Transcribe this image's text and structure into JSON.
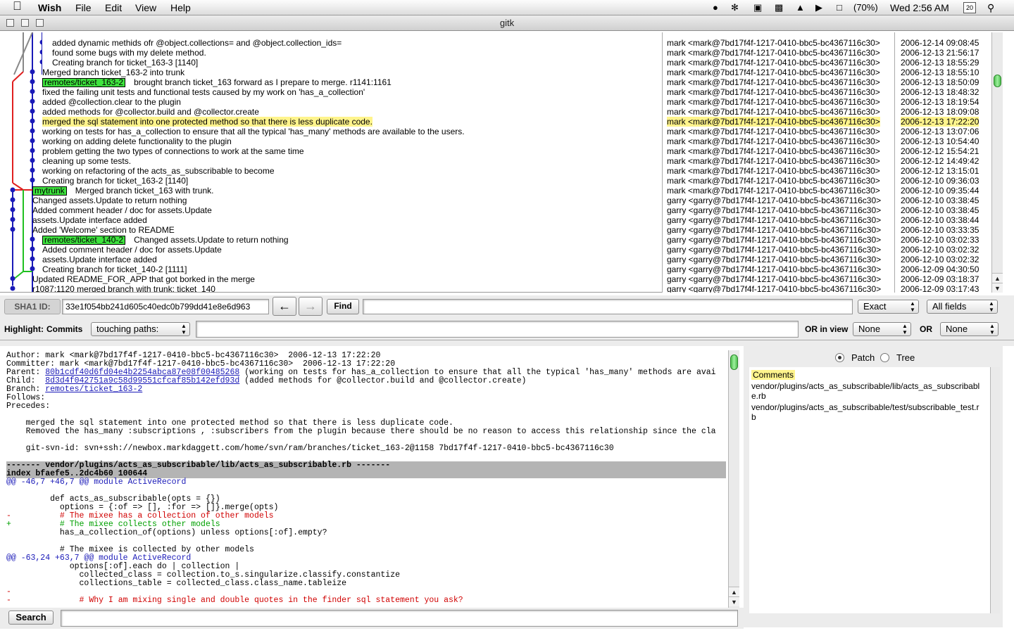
{
  "menubar": {
    "app": "Wish",
    "items": [
      "File",
      "Edit",
      "View",
      "Help"
    ],
    "battery": "(70%)",
    "clock": "Wed 2:56 AM",
    "cal_day": "20"
  },
  "window": {
    "title": "gitk"
  },
  "commits": [
    {
      "msg": "added dynamic methids ofr @object.collections= and @object.collection_ids=",
      "author": "mark <mark@7bd17f4f-1217-0410-bbc5-bc4367116c30>",
      "date": "2006-12-14 09:08:45"
    },
    {
      "msg": "found some bugs with my delete method.",
      "author": "mark <mark@7bd17f4f-1217-0410-bbc5-bc4367116c30>",
      "date": "2006-12-13 21:56:17"
    },
    {
      "msg": "Creating branch for ticket_163-3 [1140]",
      "author": "mark <mark@7bd17f4f-1217-0410-bbc5-bc4367116c30>",
      "date": "2006-12-13 18:55:29"
    },
    {
      "msg": "Merged branch ticket_163-2 into trunk",
      "author": "mark <mark@7bd17f4f-1217-0410-bbc5-bc4367116c30>",
      "date": "2006-12-13 18:55:10"
    },
    {
      "ref": "remotes/ticket_163-2",
      "msg": "brought branch ticket_163 forward as I prepare to merge. r1141:1161",
      "author": "mark <mark@7bd17f4f-1217-0410-bbc5-bc4367116c30>",
      "date": "2006-12-13 18:50:09"
    },
    {
      "msg": "fixed the failing unit tests and functional tests caused by my work on 'has_a_collection'",
      "author": "mark <mark@7bd17f4f-1217-0410-bbc5-bc4367116c30>",
      "date": "2006-12-13 18:48:32"
    },
    {
      "msg": "added @collection.clear to the plugin",
      "author": "mark <mark@7bd17f4f-1217-0410-bbc5-bc4367116c30>",
      "date": "2006-12-13 18:19:54"
    },
    {
      "msg": "added methods for @collector.build and @collector.create",
      "author": "mark <mark@7bd17f4f-1217-0410-bbc5-bc4367116c30>",
      "date": "2006-12-13 18:09:08"
    },
    {
      "msg": "merged the sql statement into one protected method so that there is less duplicate code.",
      "author": "mark <mark@7bd17f4f-1217-0410-bbc5-bc4367116c30>",
      "date": "2006-12-13 17:22:20",
      "selected": true
    },
    {
      "msg": "working on tests for has_a_collection to ensure that all the typical 'has_many' methods are available to the users.",
      "author": "mark <mark@7bd17f4f-1217-0410-bbc5-bc4367116c30>",
      "date": "2006-12-13 13:07:06"
    },
    {
      "msg": "working on adding delete functionality to the plugin",
      "author": "mark <mark@7bd17f4f-1217-0410-bbc5-bc4367116c30>",
      "date": "2006-12-13 10:54:40"
    },
    {
      "msg": "problem getting the two types of connections to work at the same time",
      "author": "mark <mark@7bd17f4f-1217-0410-bbc5-bc4367116c30>",
      "date": "2006-12-12 15:54:21"
    },
    {
      "msg": "cleaning up some tests.",
      "author": "mark <mark@7bd17f4f-1217-0410-bbc5-bc4367116c30>",
      "date": "2006-12-12 14:49:42"
    },
    {
      "msg": "working on refactoring of the acts_as_subscribable to become",
      "author": "mark <mark@7bd17f4f-1217-0410-bbc5-bc4367116c30>",
      "date": "2006-12-12 13:15:01"
    },
    {
      "msg": "Creating branch for ticket_163-2 [1140]",
      "author": "mark <mark@7bd17f4f-1217-0410-bbc5-bc4367116c30>",
      "date": "2006-12-10 09:36:03"
    },
    {
      "ref": "mytrunk",
      "msg": "Merged branch ticket_163 with trunk.",
      "author": "mark <mark@7bd17f4f-1217-0410-bbc5-bc4367116c30>",
      "date": "2006-12-10 09:35:44"
    },
    {
      "msg": "Changed assets.Update to return nothing",
      "author": "garry <garry@7bd17f4f-1217-0410-bbc5-bc4367116c30>",
      "date": "2006-12-10 03:38:45"
    },
    {
      "msg": "Added comment header / doc for assets.Update",
      "author": "garry <garry@7bd17f4f-1217-0410-bbc5-bc4367116c30>",
      "date": "2006-12-10 03:38:45"
    },
    {
      "msg": "assets.Update interface added",
      "author": "garry <garry@7bd17f4f-1217-0410-bbc5-bc4367116c30>",
      "date": "2006-12-10 03:38:44"
    },
    {
      "msg": "Added 'Welcome' section to README",
      "author": "garry <garry@7bd17f4f-1217-0410-bbc5-bc4367116c30>",
      "date": "2006-12-10 03:33:35"
    },
    {
      "ref": "remotes/ticket_140-2",
      "msg": "Changed assets.Update to return nothing",
      "author": "garry <garry@7bd17f4f-1217-0410-bbc5-bc4367116c30>",
      "date": "2006-12-10 03:02:33"
    },
    {
      "msg": "Added comment header / doc for assets.Update",
      "author": "garry <garry@7bd17f4f-1217-0410-bbc5-bc4367116c30>",
      "date": "2006-12-10 03:02:32"
    },
    {
      "msg": "assets.Update interface added",
      "author": "garry <garry@7bd17f4f-1217-0410-bbc5-bc4367116c30>",
      "date": "2006-12-10 03:02:32"
    },
    {
      "msg": "Creating branch for ticket_140-2 [1111]",
      "author": "garry <garry@7bd17f4f-1217-0410-bbc5-bc4367116c30>",
      "date": "2006-12-09 04:30:50"
    },
    {
      "msg": "Updated README_FOR_APP that got borked in the merge",
      "author": "garry <garry@7bd17f4f-1217-0410-bbc5-bc4367116c30>",
      "date": "2006-12-09 03:18:37"
    },
    {
      "msg": "r1087:1120 merged branch with trunk: ticket_140",
      "author": "garry <garry@7bd17f4f-1217-0410-bbc5-bc4367116c30>",
      "date": "2006-12-09 03:17:43"
    }
  ],
  "sha": {
    "label": "SHA1 ID:",
    "value": "33e1f054bb241d605c40edc0b799dd41e8e6d963",
    "find_label": "Find",
    "find_value": "",
    "mode": "Exact",
    "fields": "All fields"
  },
  "highlight": {
    "label": "Highlight:",
    "commits_label": "Commits",
    "paths_option": "touching paths:",
    "value": "",
    "or_in_view_label": "OR in view",
    "view_option": "None",
    "or_label": "OR",
    "or_option": "None"
  },
  "details": {
    "author": "Author: mark <mark@7bd17f4f-1217-0410-bbc5-bc4367116c30>  2006-12-13 17:22:20",
    "committer": "Committer: mark <mark@7bd17f4f-1217-0410-bbc5-bc4367116c30>  2006-12-13 17:22:20",
    "parent_label": "Parent: ",
    "parent_sha": "80b1cdf40d6fd04e4b2254abca87e08f00485268",
    "parent_msg": " (working on tests for has_a_collection to ensure that all the typical 'has_many' methods are avai",
    "child_label": "Child:  ",
    "child_sha": "8d3d4f042751a9c58d99551cfcaf85b142efd93d",
    "child_msg": " (added methods for @collector.build and @collector.create)",
    "branch_label": "Branch: ",
    "branch_name": "remotes/ticket_163-2",
    "follows": "Follows:",
    "precedes": "Precedes:",
    "body1": "    merged the sql statement into one protected method so that there is less duplicate code.",
    "body2": "    Removed the has_many :subscriptions , :subscribers from the plugin because there should be no reason to access this relationship since the cla",
    "body3": "    git-svn-id: svn+ssh://newbox.markdaggett.com/home/svn/ram/branches/ticket_163-2@1158 7bd17f4f-1217-0410-bbc5-bc4367116c30",
    "file_header": "------- vendor/plugins/acts_as_subscribable/lib/acts_as_subscribable.rb -------",
    "index_line": "index bfaefe5..2dc4b60 100644",
    "hunk1": "@@ -46,7 +46,7 @@ module ActiveRecord",
    "c1": "         def acts_as_subscribable(opts = {})",
    "c2": "           options = {:of => [], :for => []}.merge(opts)",
    "c3": "-          # The mixee has a collection of other models",
    "c4": "+          # The mixee collects other models",
    "c5": "           has_a_collection_of(options) unless options[:of].empty?",
    "c6": "",
    "c7": "           # The mixee is collected by other models",
    "hunk2": "@@ -63,24 +63,7 @@ module ActiveRecord",
    "c8": "             options[:of].each do | collection |",
    "c9": "               collected_class = collection.to_s.singularize.classify.constantize",
    "c10": "               collections_table = collected_class.class_name.tableize",
    "c11": "-",
    "c12": "-              # Why I am mixing single and double quotes in the finder sql statement you ask?"
  },
  "files": {
    "patch_label": "Patch",
    "tree_label": "Tree",
    "comments_label": "Comments",
    "file1": "vendor/plugins/acts_as_subscribable/lib/acts_as_subscribabl",
    "file1b": "e.rb",
    "file2": "vendor/plugins/acts_as_subscribable/test/subscribable_test.r",
    "file2b": "b"
  },
  "search": {
    "button_label": "Search",
    "value": ""
  },
  "colors": {
    "ref": "#3ee43e",
    "highlight": "#fff48c",
    "hunk": "#1a1ab8",
    "removed": "#d00000",
    "added": "#00a000"
  }
}
